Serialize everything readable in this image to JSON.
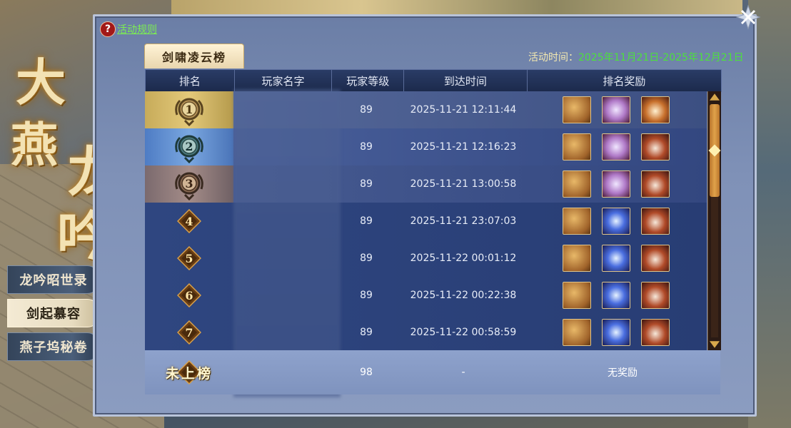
{
  "game_title": [
    "大",
    "燕",
    "龙",
    "吟"
  ],
  "side_menu": [
    {
      "label": "龙吟昭世录",
      "active": false
    },
    {
      "label": "剑起慕容",
      "active": true
    },
    {
      "label": "燕子坞秘卷",
      "active": false
    }
  ],
  "panel": {
    "help_link": "活动规则",
    "help_icon": "?",
    "board_tab": "剑啸凌云榜",
    "event_time_label": "活动时间：",
    "event_time_value": "2025年11月21日-2025年12月21日"
  },
  "table": {
    "headers": [
      "排名",
      "玩家名字",
      "玩家等级",
      "到达时间",
      "排名奖励"
    ],
    "rows": [
      {
        "rank": "1",
        "level": "89",
        "time": "2025-11-21  12:11:44",
        "rewards": [
          "book-icon",
          "fan-icon",
          "chest-icon"
        ]
      },
      {
        "rank": "2",
        "level": "89",
        "time": "2025-11-21  12:16:23",
        "rewards": [
          "book-icon",
          "fan-icon",
          "chest-icon"
        ]
      },
      {
        "rank": "3",
        "level": "89",
        "time": "2025-11-21  13:00:58",
        "rewards": [
          "book-icon",
          "fan-icon",
          "chest-icon"
        ]
      },
      {
        "rank": "4",
        "level": "89",
        "time": "2025-11-21  23:07:03",
        "rewards": [
          "book-icon",
          "fan-icon",
          "chest-icon"
        ]
      },
      {
        "rank": "5",
        "level": "89",
        "time": "2025-11-22  00:01:12",
        "rewards": [
          "book-icon",
          "fan-icon",
          "chest-icon"
        ]
      },
      {
        "rank": "6",
        "level": "89",
        "time": "2025-11-22  00:22:38",
        "rewards": [
          "book-icon",
          "fan-icon",
          "chest-icon"
        ]
      },
      {
        "rank": "7",
        "level": "89",
        "time": "2025-11-22  00:58:59",
        "rewards": [
          "book-icon",
          "fan-icon",
          "chest-icon"
        ]
      }
    ],
    "my_row": {
      "rank": "未上榜",
      "level": "98",
      "time": "-",
      "reward": "无奖励"
    }
  },
  "colors": {
    "accent_green": "#4de03c",
    "link_green": "#7df050",
    "gold": "#e3c97a",
    "header_bg": "#1c2a4c"
  }
}
